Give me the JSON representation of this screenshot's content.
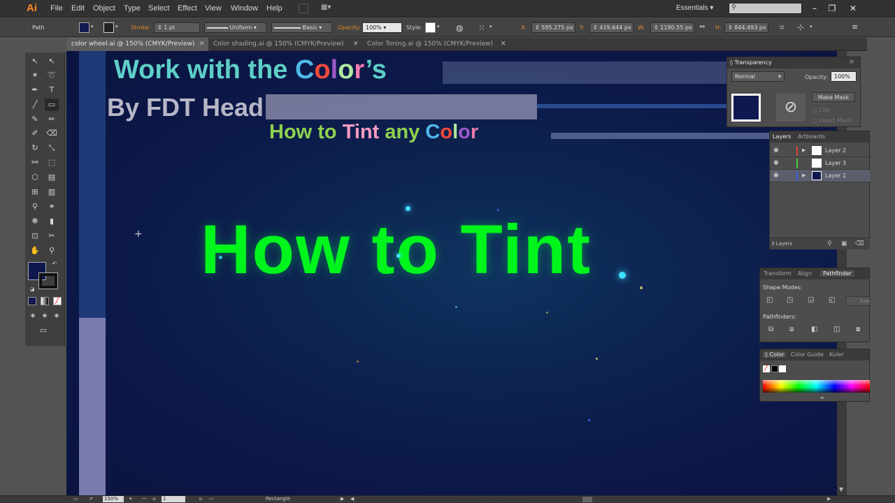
{
  "app": {
    "logo": "Ai",
    "workspace": "Essentials",
    "search_placeholder": ""
  },
  "menu": [
    "File",
    "Edit",
    "Object",
    "Type",
    "Select",
    "Effect",
    "View",
    "Window",
    "Help"
  ],
  "control_bar": {
    "selection_type": "Path",
    "stroke_label": "Stroke:",
    "stroke_weight": "1 pt",
    "stroke_profile": "Uniform",
    "brush": "Basic",
    "opacity_label": "Opacity:",
    "opacity_value": "100%",
    "style_label": "Style:",
    "x_label": "X:",
    "x_value": "595.275 px",
    "y_label": "Y:",
    "y_value": "419.644 px",
    "w_label": "W:",
    "w_value": "1190.55 px",
    "h_label": "H:",
    "h_value": "844.493 px"
  },
  "tabs": [
    {
      "label": "color wheel.ai @ 150% (CMYK/Preview)",
      "active": true
    },
    {
      "label": "Color shading.ai @ 150% (CMYK/Preview)",
      "active": false
    },
    {
      "label": "Color Toning.ai @ 150% (CMYK/Preview)",
      "active": false
    }
  ],
  "artwork": {
    "title_part1": "Work with the ",
    "title_part2": [
      "C",
      "o",
      "l",
      "o",
      "r",
      "’s"
    ],
    "byline": "By FDT Head",
    "subtitle_part1": "How to ",
    "subtitle_tint": "Tint",
    "subtitle_part2": " any ",
    "subtitle_color": [
      "C",
      "o",
      "l",
      "o",
      "r"
    ],
    "main_text": "How to Tint"
  },
  "colors": {
    "title_teal": "#5ecfc8",
    "color_letters": [
      "#4fb8e8",
      "#f04a3a",
      "#9b59c9",
      "#b0e8a0",
      "#f07ab0"
    ],
    "subtitle_green": "#8ed14f",
    "tint_pink": "#f59ac0",
    "main_green": "#00f51c",
    "fill_swatch": "#101850"
  },
  "transparency_panel": {
    "title": "Transparency",
    "blend_mode": "Normal",
    "opacity_label": "Opacity:",
    "opacity_value": "100%",
    "make_mask": "Make Mask",
    "clip": "Clip",
    "invert_mask": "Invert Mask"
  },
  "layers_panel": {
    "tabs": [
      "Layers",
      "Artboards"
    ],
    "layers": [
      {
        "name": "Layer 2",
        "color": "#e04040"
      },
      {
        "name": "Layer 3",
        "color": "#40d040"
      },
      {
        "name": "Layer 1",
        "color": "#4060e0"
      }
    ],
    "count": "3 Layers"
  },
  "pathfinder_panel": {
    "tabs": [
      "Transform",
      "Align",
      "Pathfinder"
    ],
    "shape_modes": "Shape Modes:",
    "pathfinders": "Pathfinders:",
    "expand": "Expand"
  },
  "color_panel": {
    "tabs": [
      "Color",
      "Color Guide",
      "Kuler"
    ]
  },
  "status": {
    "zoom": "150%",
    "artboard": "1",
    "tool": "Rectangle"
  }
}
